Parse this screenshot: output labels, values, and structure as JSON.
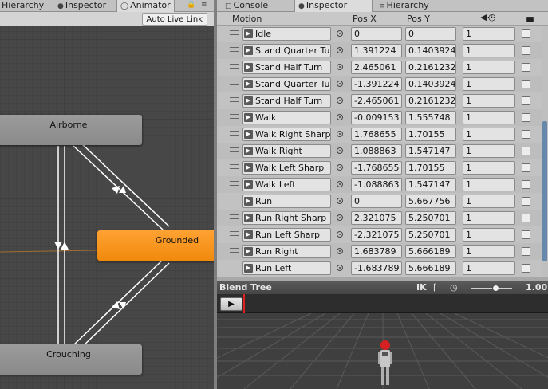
{
  "left_tabs": [
    {
      "label": "Hierarchy",
      "icon": "hierarchy-icon"
    },
    {
      "label": "Inspector",
      "icon": "info-icon"
    },
    {
      "label": "Animator",
      "icon": "animator-icon"
    }
  ],
  "animator": {
    "live_link_label": "Auto Live Link",
    "states": [
      {
        "name": "Airborne",
        "color": "#8f8f8f"
      },
      {
        "name": "Grounded",
        "color": "#f48f1c"
      },
      {
        "name": "Crouching",
        "color": "#8f8f8f"
      }
    ]
  },
  "right_tabs": [
    {
      "label": "Console",
      "icon": "console-icon"
    },
    {
      "label": "Inspector",
      "icon": "info-icon"
    },
    {
      "label": "Hierarchy",
      "icon": "hierarchy-icon"
    }
  ],
  "motion_table": {
    "headers": {
      "motion": "Motion",
      "pos_x": "Pos X",
      "pos_y": "Pos Y"
    },
    "rows": [
      {
        "motion": "Idle",
        "pos_x": "0",
        "pos_y": "0",
        "speed": "1"
      },
      {
        "motion": "Stand Quarter Turn",
        "pos_x": "1.391224",
        "pos_y": "0.1403924",
        "speed": "1"
      },
      {
        "motion": "Stand Half Turn",
        "pos_x": "2.465061",
        "pos_y": "0.2161232",
        "speed": "1"
      },
      {
        "motion": "Stand Quarter Turn",
        "pos_x": "-1.391224",
        "pos_y": "0.1403924",
        "speed": "1"
      },
      {
        "motion": "Stand Half Turn",
        "pos_x": "-2.465061",
        "pos_y": "0.2161232",
        "speed": "1"
      },
      {
        "motion": "Walk",
        "pos_x": "-0.009153",
        "pos_y": "1.555748",
        "speed": "1"
      },
      {
        "motion": "Walk Right Sharp",
        "pos_x": "1.768655",
        "pos_y": "1.70155",
        "speed": "1"
      },
      {
        "motion": "Walk Right",
        "pos_x": "1.088863",
        "pos_y": "1.547147",
        "speed": "1"
      },
      {
        "motion": "Walk Left Sharp",
        "pos_x": "-1.768655",
        "pos_y": "1.70155",
        "speed": "1"
      },
      {
        "motion": "Walk Left",
        "pos_x": "-1.088863",
        "pos_y": "1.547147",
        "speed": "1"
      },
      {
        "motion": "Run",
        "pos_x": "0",
        "pos_y": "5.667756",
        "speed": "1"
      },
      {
        "motion": "Run Right Sharp",
        "pos_x": "2.321075",
        "pos_y": "5.250701",
        "speed": "1"
      },
      {
        "motion": "Run Left Sharp",
        "pos_x": "-2.321075",
        "pos_y": "5.250701",
        "speed": "1"
      },
      {
        "motion": "Run Right",
        "pos_x": "1.683789",
        "pos_y": "5.666189",
        "speed": "1"
      },
      {
        "motion": "Run Left",
        "pos_x": "-1.683789",
        "pos_y": "5.666189",
        "speed": "1"
      }
    ]
  },
  "blend_tree": {
    "title": "Blend Tree",
    "ik_label": "IK",
    "speed_value": "1.00",
    "play_icon": "play-icon"
  },
  "colors": {
    "grounded": "#f48f1c",
    "playhead": "#e02020",
    "character_accent": "#d42020"
  }
}
